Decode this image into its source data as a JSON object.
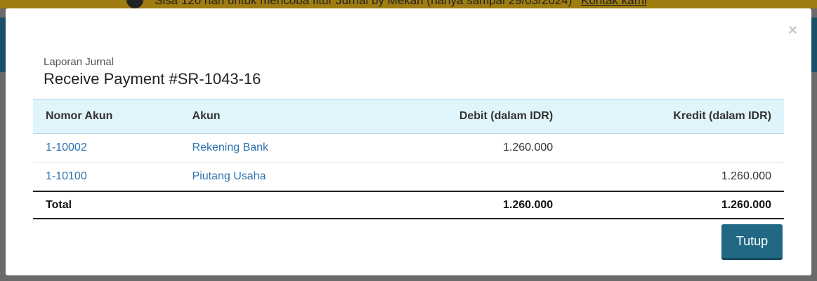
{
  "background": {
    "banner_text": "Sisa 120 hari untuk mencoba fitur Jurnal by Mekari (hanya sampai 29/03/2024)",
    "banner_link": "Kontak kami"
  },
  "modal": {
    "close_icon": "×",
    "subtitle": "Laporan Jurnal",
    "title": "Receive Payment #SR-1043-16",
    "table": {
      "headers": {
        "nomor_akun": "Nomor Akun",
        "akun": "Akun",
        "debit": "Debit (dalam IDR)",
        "kredit": "Kredit (dalam IDR)"
      },
      "rows": [
        {
          "nomor_akun": "1-10002",
          "akun": "Rekening Bank",
          "debit": "1.260.000",
          "kredit": ""
        },
        {
          "nomor_akun": "1-10100",
          "akun": "Piutang Usaha",
          "debit": "",
          "kredit": "1.260.000"
        }
      ],
      "total": {
        "label": "Total",
        "debit": "1.260.000",
        "kredit": "1.260.000"
      }
    },
    "close_button_label": "Tutup"
  },
  "colors": {
    "link": "#2f73ad",
    "header_bg": "#e0f4fb",
    "primary_button": "#216885",
    "overlay": "#6a6a6a"
  }
}
